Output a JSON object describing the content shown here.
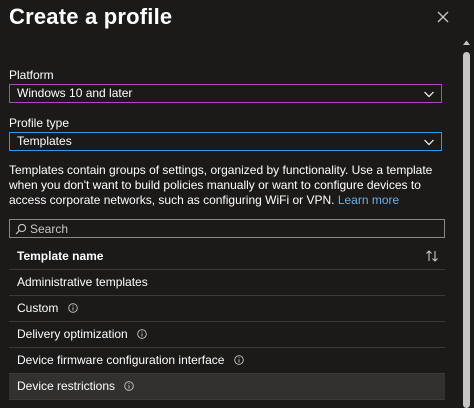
{
  "header": {
    "title": "Create a profile"
  },
  "platform": {
    "label": "Platform",
    "value": "Windows 10 and later"
  },
  "profile_type": {
    "label": "Profile type",
    "value": "Templates"
  },
  "description": {
    "text": "Templates contain groups of settings, organized by functionality. Use a template when you don't want to build policies manually or want to configure devices to access corporate networks, such as configuring WiFi or VPN.",
    "link": "Learn more"
  },
  "search": {
    "placeholder": "Search"
  },
  "table": {
    "header": "Template name",
    "rows": [
      {
        "label": "Administrative templates"
      },
      {
        "label": "Custom"
      },
      {
        "label": "Delivery optimization"
      },
      {
        "label": "Device firmware configuration interface"
      },
      {
        "label": "Device restrictions"
      }
    ]
  },
  "icons": {
    "close": "close-icon",
    "chevron": "chevron-down-icon",
    "search": "search-icon",
    "sort": "sort-icon",
    "info": "info-icon"
  },
  "colors": {
    "background": "#1b1a19",
    "platform_border": "#b146c2",
    "profile_type_border": "#2899f5",
    "link": "#69afe5",
    "selected_row": "#323130"
  }
}
